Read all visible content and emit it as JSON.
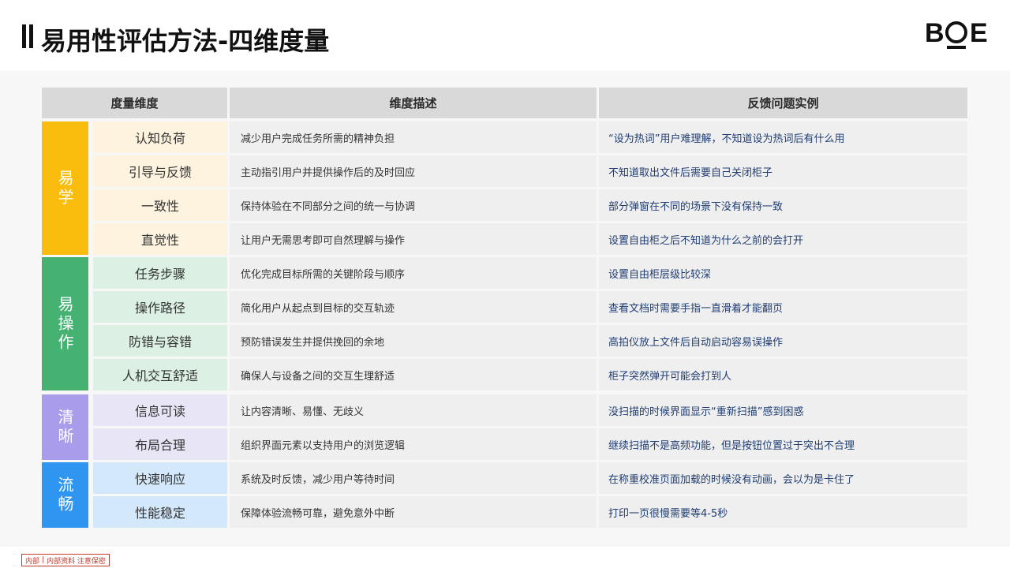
{
  "header": {
    "title": "易用性评估方法-四维度量",
    "logo_text": "BOE"
  },
  "table": {
    "columns": [
      "度量维度",
      "维度描述",
      "反馈问题实例"
    ],
    "groups": [
      {
        "name": "易学",
        "color": "#fbbd0d",
        "light": "#fdf3df"
      },
      {
        "name": "易操作",
        "color": "#46b272",
        "light": "#dcf1e4"
      },
      {
        "name": "清晰",
        "color": "#a99ceb",
        "light": "#e8e6f6"
      },
      {
        "name": "流畅",
        "color": "#2e96f0",
        "light": "#d4e8fc"
      }
    ],
    "rows": [
      {
        "dim": "认知负荷",
        "desc": "减少用户完成任务所需的精神负担",
        "example": "“设为热词”用户难理解，不知道设为热词后有什么用"
      },
      {
        "dim": "引导与反馈",
        "desc": "主动指引用户并提供操作后的及时回应",
        "example": "不知道取出文件后需要自己关闭柜子"
      },
      {
        "dim": "一致性",
        "desc": "保持体验在不同部分之间的统一与协调",
        "example": "部分弹窗在不同的场景下没有保持一致"
      },
      {
        "dim": "直觉性",
        "desc": "让用户无需思考即可自然理解与操作",
        "example": "设置自由柜之后不知道为什么之前的会打开"
      },
      {
        "dim": "任务步骤",
        "desc": "优化完成目标所需的关键阶段与顺序",
        "example": "设置自由柜层级比较深"
      },
      {
        "dim": "操作路径",
        "desc": "简化用户从起点到目标的交互轨迹",
        "example": "查看文档时需要手指一直滑着才能翻页"
      },
      {
        "dim": "防错与容错",
        "desc": "预防错误发生并提供挽回的余地",
        "example": "高拍仪放上文件后自动启动容易误操作"
      },
      {
        "dim": "人机交互舒适",
        "desc": "确保人与设备之间的交互生理舒适",
        "example": "柜子突然弹开可能会打到人"
      },
      {
        "dim": "信息可读",
        "desc": "让内容清晰、易懂、无歧义",
        "example": "没扫描的时候界面显示“重新扫描”感到困惑"
      },
      {
        "dim": "布局合理",
        "desc": "组织界面元素以支持用户的浏览逻辑",
        "example": "继续扫描不是高频功能，但是按钮位置过于突出不合理"
      },
      {
        "dim": "快速响应",
        "desc": "系统及时反馈，减少用户等待时间",
        "example": "在称重校准页面加载的时候没有动画，会以为是卡住了"
      },
      {
        "dim": "性能稳定",
        "desc": "保障体验流畅可靠，避免意外中断",
        "example": "打印一页很慢需要等4-5秒"
      }
    ]
  },
  "footer": {
    "tag_main": "内部",
    "tag_sub": "内部资料 注意保密"
  }
}
